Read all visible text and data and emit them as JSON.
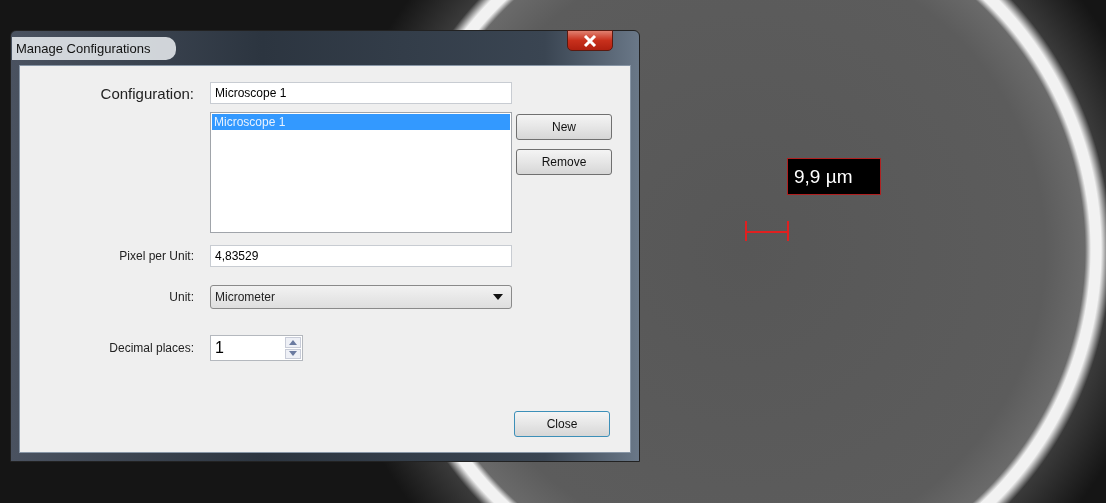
{
  "window": {
    "title": "Manage Configurations"
  },
  "configuration": {
    "label": "Configuration:",
    "value": "Microscope 1"
  },
  "configurations_list": [
    {
      "label": "Microscope 1",
      "selected": true
    }
  ],
  "buttons": [
    {
      "label": "New"
    },
    {
      "label": "Remove"
    }
  ],
  "pixel_per_unit": {
    "label": "Pixel per Unit:",
    "value": "4,83529"
  },
  "unit": {
    "label": "Unit:",
    "value": "Micrometer"
  },
  "decimal_places": {
    "label": "Decimal places:",
    "value": "1"
  },
  "close_button": "Close",
  "measurement": {
    "reading": "9,9 µm"
  }
}
